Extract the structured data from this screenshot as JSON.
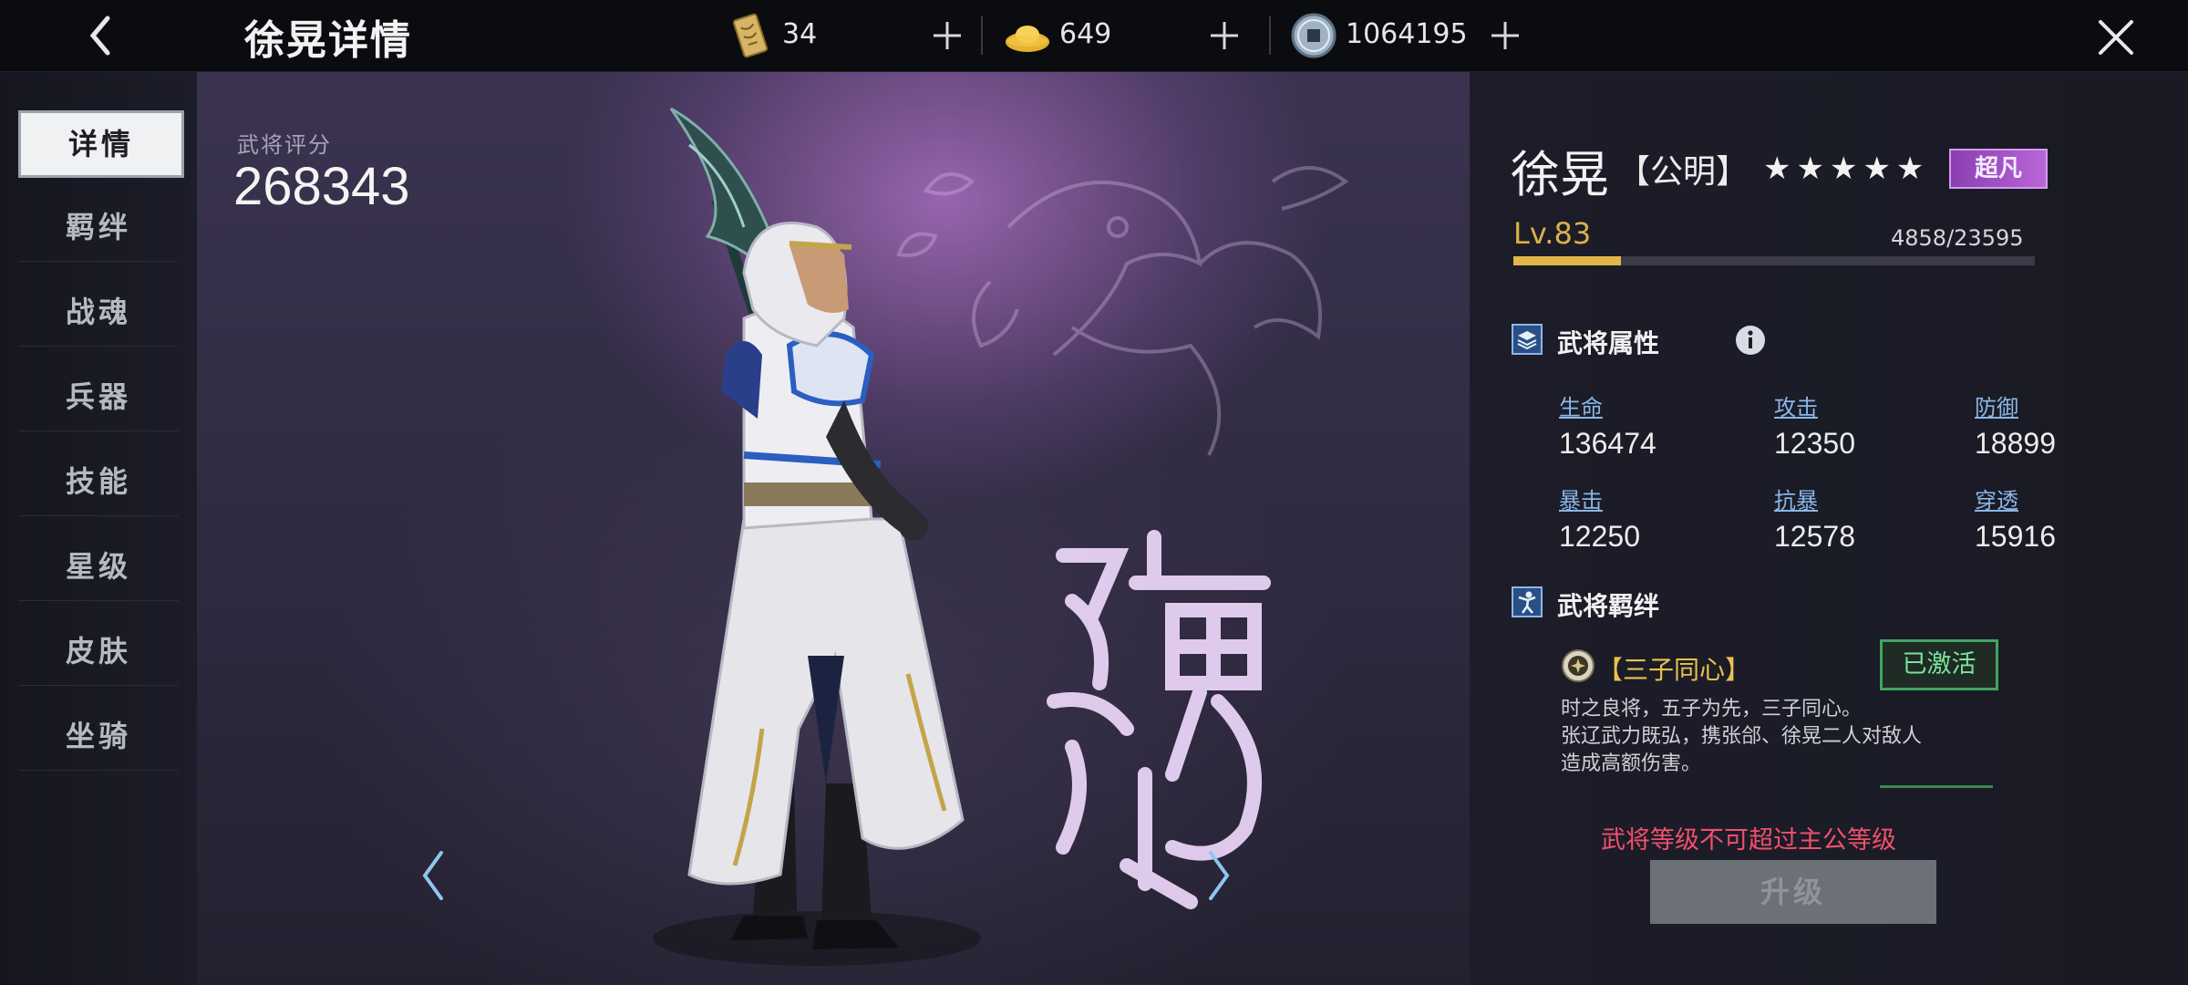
{
  "header": {
    "title": "徐晃详情",
    "resources": [
      {
        "icon": "token-scroll-icon",
        "value": "34"
      },
      {
        "icon": "gold-ingot-icon",
        "value": "649"
      },
      {
        "icon": "copper-coin-icon",
        "value": "1064195"
      }
    ]
  },
  "sidebar": {
    "tabs": [
      "详情",
      "羁绊",
      "战魂",
      "兵器",
      "技能",
      "星级",
      "皮肤",
      "坐骑"
    ],
    "active_index": 0
  },
  "stage": {
    "score_label": "武将评分",
    "score_value": "268343",
    "kingdom_glyph_icon": "wei-seal-icon"
  },
  "hero": {
    "name": "徐晃",
    "courtesy": "【公明】",
    "stars": "★★★★★",
    "star_count": 5,
    "rarity": "超凡",
    "level": "Lv.83",
    "exp": "4858/23595",
    "exp_fraction": 0.206
  },
  "attributes": {
    "title": "武将属性",
    "stats": [
      {
        "name": "生命",
        "value": "136474"
      },
      {
        "name": "攻击",
        "value": "12350"
      },
      {
        "name": "防御",
        "value": "18899"
      },
      {
        "name": "暴击",
        "value": "12250"
      },
      {
        "name": "抗暴",
        "value": "12578"
      },
      {
        "name": "穿透",
        "value": "15916"
      }
    ]
  },
  "bonds": {
    "title": "武将羁绊",
    "name": "【三子同心】",
    "status": "已激活",
    "desc": [
      "时之良将，五子为先，三子同心。",
      "张辽武力既弘，携张郃、徐晃二人对敌人",
      "造成高额伤害。"
    ]
  },
  "footer": {
    "warning": "武将等级不可超过主公等级",
    "upgrade_label": "升级"
  },
  "colors": {
    "level_gold": "#e3b64a",
    "rarity_purple": "#b865d8",
    "active_green": "#3fa65f",
    "warning_red": "#f0506a"
  }
}
